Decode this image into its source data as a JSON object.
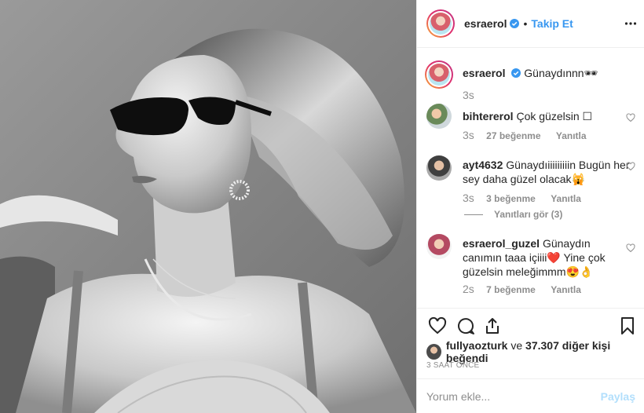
{
  "post": {
    "author": "esraerol",
    "dot": "•",
    "follow_label": "Takip Et",
    "photo_description": "black-and-white portrait of a woman in sunglasses"
  },
  "caption": {
    "username": "esraerol",
    "text": "Günaydınnn🕶",
    "time": "3s"
  },
  "comments": [
    {
      "username": "bihtererol",
      "text": "Çok güzelsin ☐",
      "time": "3s",
      "likes": "27 beğenme",
      "reply": "Yanıtla"
    },
    {
      "username": "ayt4632",
      "text": "Günaydıiiiiiiiiin Bugün her sey daha güzel olacak🙀",
      "time": "3s",
      "likes": "3 beğenme",
      "reply": "Yanıtla",
      "view_replies": "Yanıtları gör (3)"
    },
    {
      "username": "esraerol_guzel",
      "text": "Günaydın canımın taaa içiiii❤️  Yine çok güzelsin meleğimmm😍👌",
      "time": "2s",
      "likes": "7 beğenme",
      "reply": "Yanıtla"
    }
  ],
  "likes": {
    "user": "fullyaozturk",
    "connector": "ve",
    "rest": "37.307 diğer kişi beğendi"
  },
  "time_ago": "3 SAAT ÖNCE",
  "compose": {
    "placeholder": "Yorum ekle...",
    "post_label": "Paylaş"
  },
  "colors": {
    "link_blue": "#3897f0",
    "muted": "#8e8e8e",
    "text": "#262626",
    "post_disabled": "#b2dffc"
  }
}
